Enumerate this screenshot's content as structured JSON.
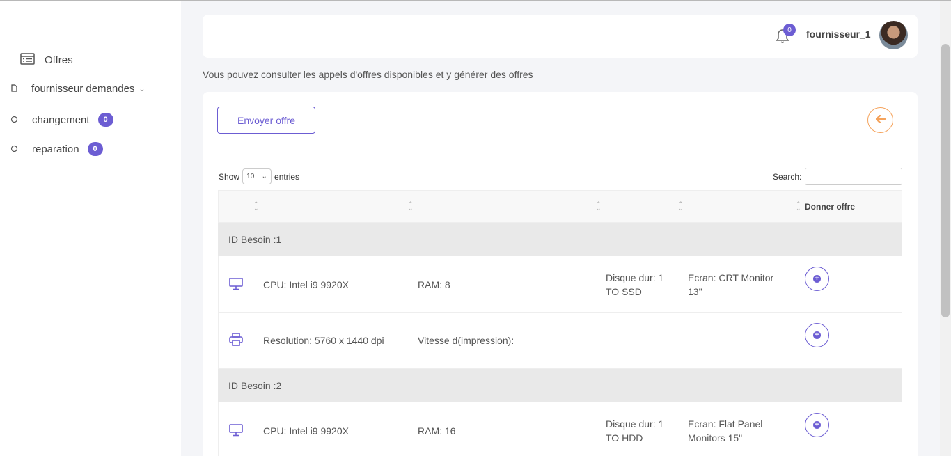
{
  "sidebar": {
    "items": [
      {
        "label": "Offres",
        "icon": "list-icon"
      },
      {
        "label": "fournisseur demandes",
        "icon": "file-icon"
      },
      {
        "label": "changement",
        "icon": "circle-icon",
        "badge": "0"
      },
      {
        "label": "reparation",
        "icon": "circle-icon",
        "badge": "0"
      }
    ]
  },
  "header": {
    "notification_count": "0",
    "username": "fournisseur_1"
  },
  "subtitle": "Vous pouvez consulter les appels d'offres disponibles et y générer des offres",
  "toolbar": {
    "send_label": "Envoyer offre"
  },
  "datatable": {
    "show_label": "Show",
    "length_value": "10",
    "entries_label": "entries",
    "search_label": "Search:",
    "column_offer": "Donner offre"
  },
  "groups": [
    {
      "label": "ID Besoin :1",
      "rows": [
        {
          "icon": "monitor-icon",
          "c1": "CPU: Intel i9 9920X",
          "c2": "RAM: 8",
          "c3a": "Disque dur: 1",
          "c3b": "TO SSD",
          "c4a": "Ecran: CRT Monitor",
          "c4b": "13\""
        },
        {
          "icon": "printer-icon",
          "c1": "Resolution: 5760 x 1440 dpi",
          "c2": "Vitesse d(impression):",
          "c3a": "",
          "c3b": "",
          "c4a": "",
          "c4b": ""
        }
      ]
    },
    {
      "label": "ID Besoin :2",
      "rows": [
        {
          "icon": "monitor-icon",
          "c1": "CPU: Intel i9 9920X",
          "c2": "RAM: 16",
          "c3a": "Disque dur: 1",
          "c3b": "TO HDD",
          "c4a": "Ecran: Flat Panel",
          "c4b": "Monitors 15\""
        }
      ]
    }
  ],
  "colors": {
    "accent": "#6c5dd3",
    "back_button": "#f5a35c"
  }
}
